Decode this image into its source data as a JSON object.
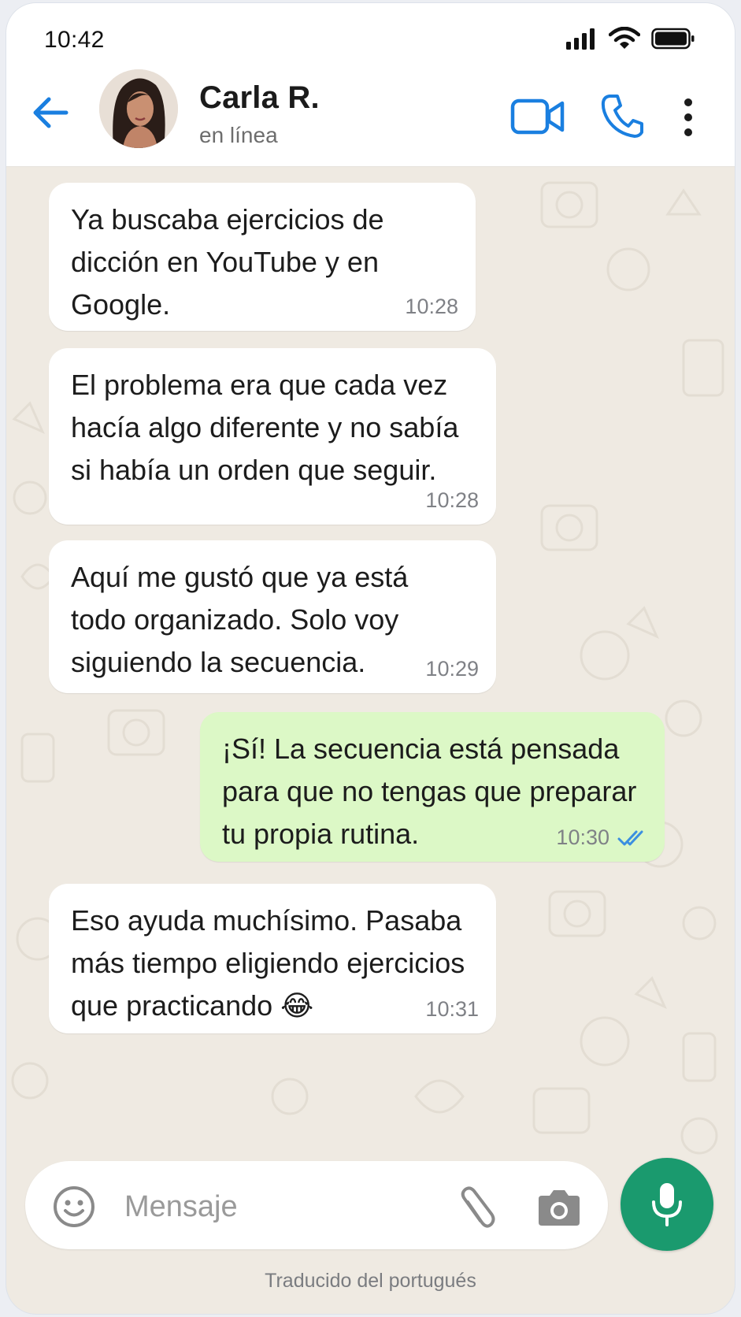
{
  "status_bar": {
    "time": "10:42",
    "icons": [
      "signal-icon",
      "wifi-icon",
      "battery-icon"
    ]
  },
  "header": {
    "contact_name": "Carla R.",
    "contact_status": "en línea",
    "icons": [
      "back-arrow-icon",
      "video-call-icon",
      "phone-icon",
      "more-vertical-icon"
    ]
  },
  "messages": [
    {
      "direction": "incoming",
      "lines": [
        "Ya buscaba ejercicios de",
        "dicción en YouTube y en",
        "Google."
      ],
      "time": "10:28"
    },
    {
      "direction": "incoming",
      "lines": [
        "El problema era que cada vez",
        "hacía algo diferente y no sabía",
        "si había un orden que seguir."
      ],
      "time": "10:28"
    },
    {
      "direction": "incoming",
      "lines": [
        "Aquí me gustó que ya está",
        "todo organizado. Solo voy",
        "siguiendo la secuencia."
      ],
      "time": "10:29"
    },
    {
      "direction": "outgoing",
      "lines": [
        "¡Sí! La secuencia está pensada",
        "para que no tengas que preparar",
        "tu propia rutina."
      ],
      "time": "10:30",
      "status": "read"
    },
    {
      "direction": "incoming",
      "lines": [
        "Eso ayuda muchísimo. Pasaba",
        "más tiempo eligiendo ejercicios",
        "que practicando 😂"
      ],
      "time": "10:31"
    }
  ],
  "composer": {
    "placeholder": "Mensaje",
    "value": ""
  },
  "footer_note": "Traducido del portugués",
  "colors": {
    "accent_blue": "#1a7fe0",
    "outgoing_bubble": "#dcf8c6",
    "incoming_bubble": "#ffffff",
    "mic_button": "#1a9a6e",
    "wallpaper": "#efeae2",
    "read_ticks": "#3b8fe0"
  }
}
